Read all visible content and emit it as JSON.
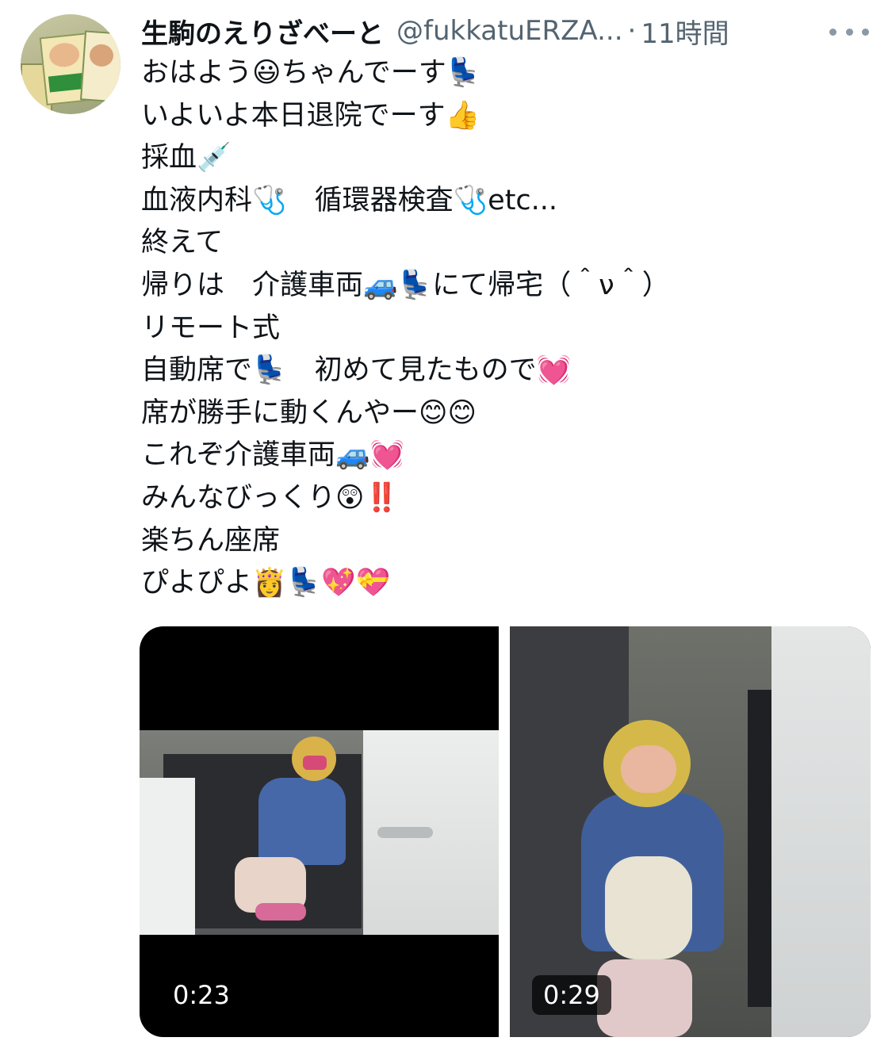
{
  "author": {
    "display_name": "生駒のえりざべーと",
    "handle": "@fukkatuERZA...",
    "separator": "·",
    "time": "11時間"
  },
  "more_icon": "more-horizontal-icon",
  "tweet": {
    "lines": [
      "おはよう😃ちゃんでーす💺",
      "いよいよ本日退院でーす👍",
      "採血💉",
      "血液内科🩺　循環器検査🩺etc...",
      "終えて",
      "帰りは　介護車両🚙💺にて帰宅（＾ν＾）",
      "リモート式",
      "自動席で💺　初めて見たもので💓",
      "席が勝手に動くんやー😊😊",
      "これぞ介護車両🚙💓",
      "みんなびっくり😲‼️",
      "楽ちん座席",
      "ぴよぴよ👸💺💖💝"
    ]
  },
  "media": {
    "videos": [
      {
        "duration": "0:23",
        "play_progress": 0
      },
      {
        "duration": "0:29",
        "play_progress": 0
      }
    ]
  }
}
